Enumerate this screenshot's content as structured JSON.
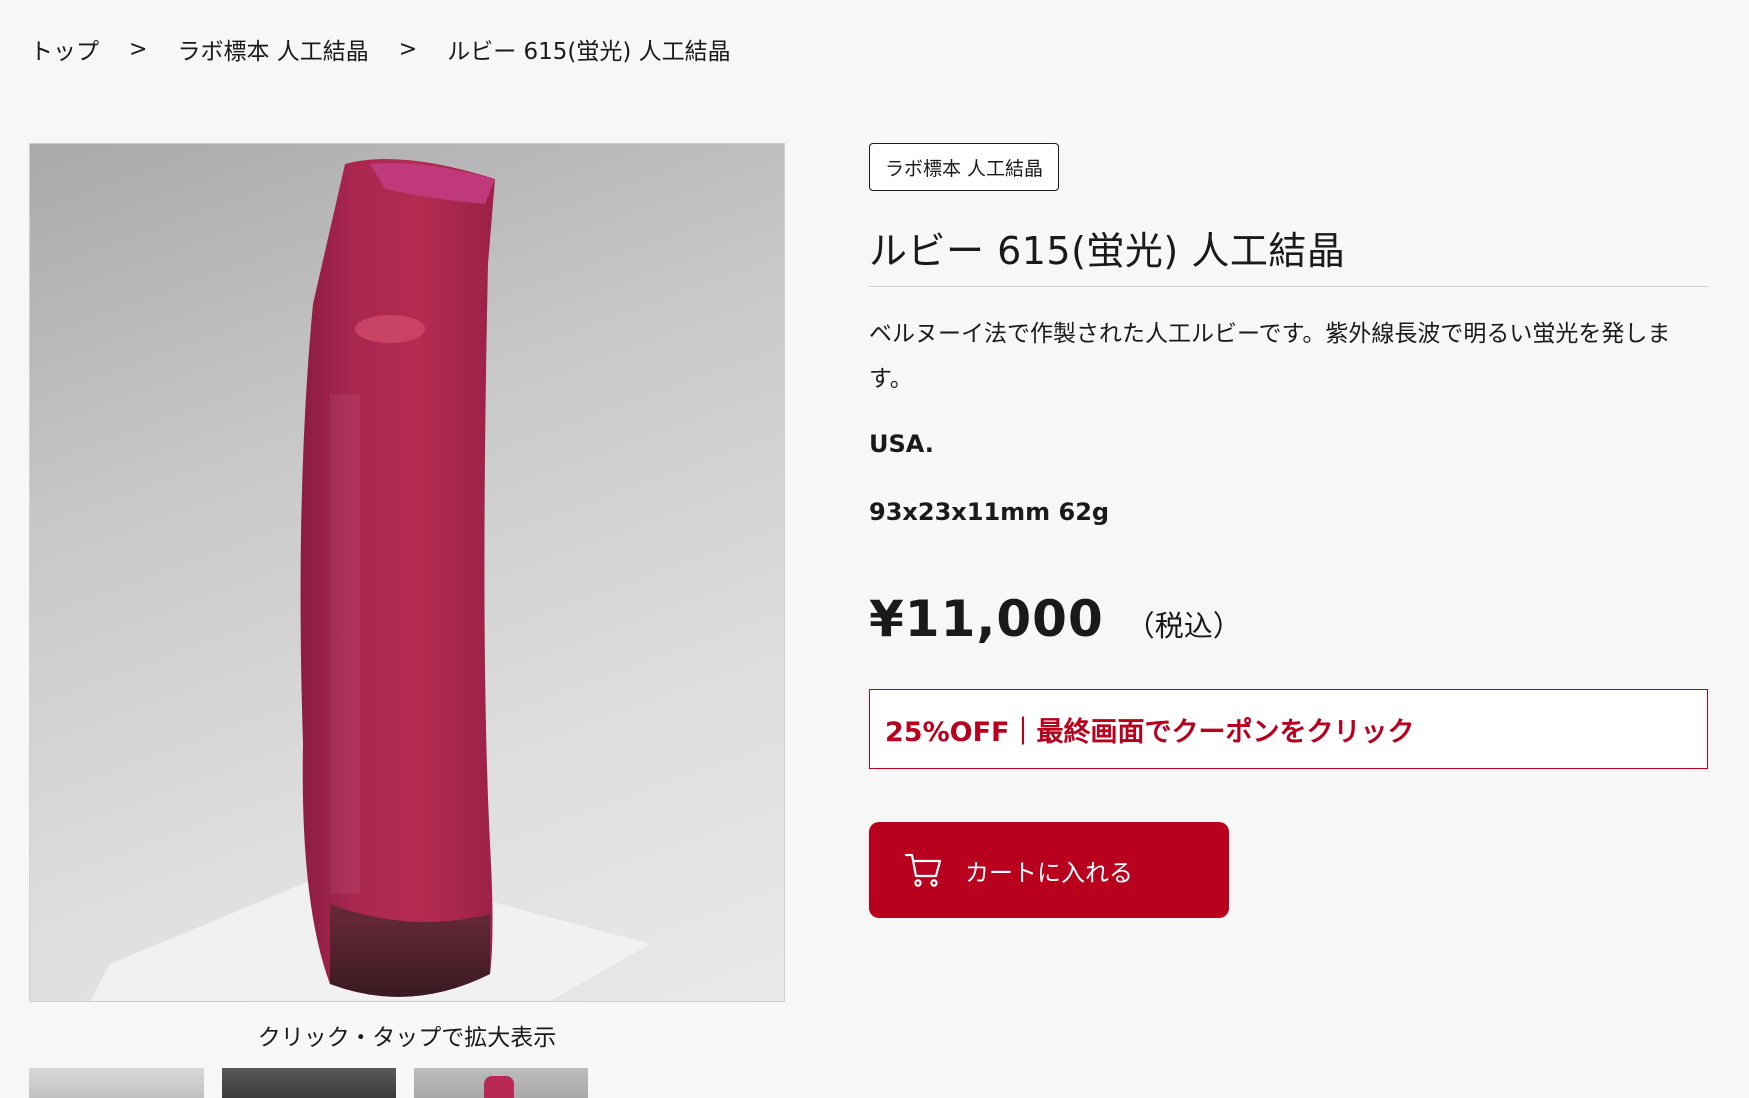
{
  "breadcrumb": {
    "items": [
      "トップ",
      "ラボ標本 人工結晶",
      "ルビー 615(蛍光) 人工結晶"
    ],
    "separator": ">"
  },
  "gallery": {
    "caption": "クリック・タップで拡大表示"
  },
  "product": {
    "category": "ラボ標本 人工結晶",
    "title": "ルビー 615(蛍光) 人工結晶",
    "description": "ベルヌーイ法で作製された人工ルビーです。紫外線長波で明るい蛍光を発します。",
    "origin": "USA.",
    "size": "93x23x11mm 62g",
    "price": "¥11,000",
    "tax_note": "（税込）",
    "coupon": "25%OFF｜最終画面でクーポンをクリック",
    "cart_button": "カートに入れる"
  },
  "colors": {
    "accent": "#b8001e",
    "background": "#f7f7f7"
  },
  "icons": {
    "cart": "cart-icon"
  }
}
